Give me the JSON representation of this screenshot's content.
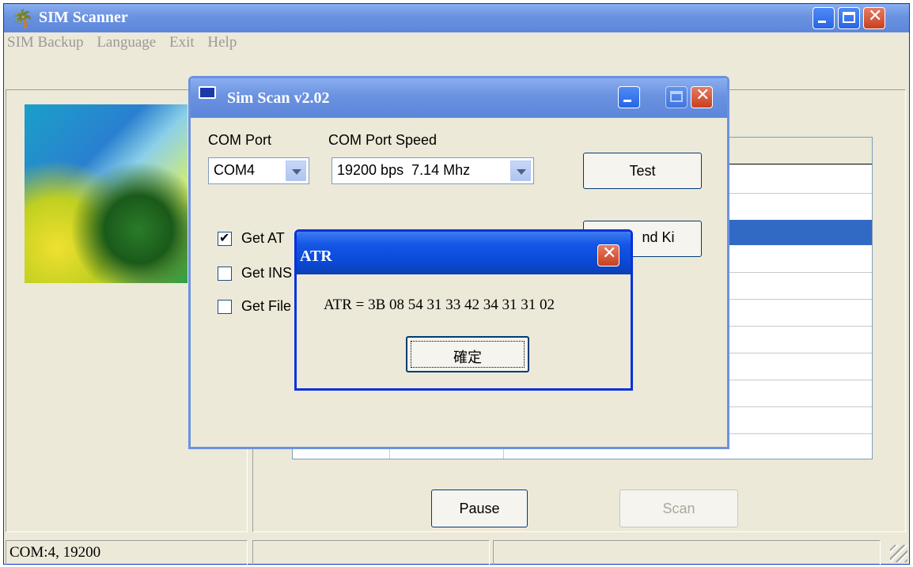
{
  "main_window": {
    "title": "SIM Scanner",
    "menu": [
      "SIM Backup",
      "Language",
      "Exit",
      "Help"
    ],
    "buttons": {
      "pause": "Pause",
      "scan": "Scan"
    },
    "status": {
      "port": "COM:4, 19200"
    }
  },
  "sim_scan_dialog": {
    "title": "Sim Scan v2.02",
    "com_port_label": "COM Port",
    "com_port_value": "COM4",
    "com_speed_label": "COM Port Speed",
    "com_speed_value": "19200 bps  7.14 Mhz",
    "test_button": "Test",
    "find_ki_button_partial": "nd Ki",
    "checkboxes": [
      {
        "label": "Get AT",
        "checked": true
      },
      {
        "label": "Get INS",
        "checked": false
      },
      {
        "label": "Get File",
        "checked": false
      }
    ]
  },
  "atr_dialog": {
    "title": "ATR",
    "message": "ATR = 3B 08 54 31 33 42 34 31 31 02",
    "ok_button": "確定"
  }
}
